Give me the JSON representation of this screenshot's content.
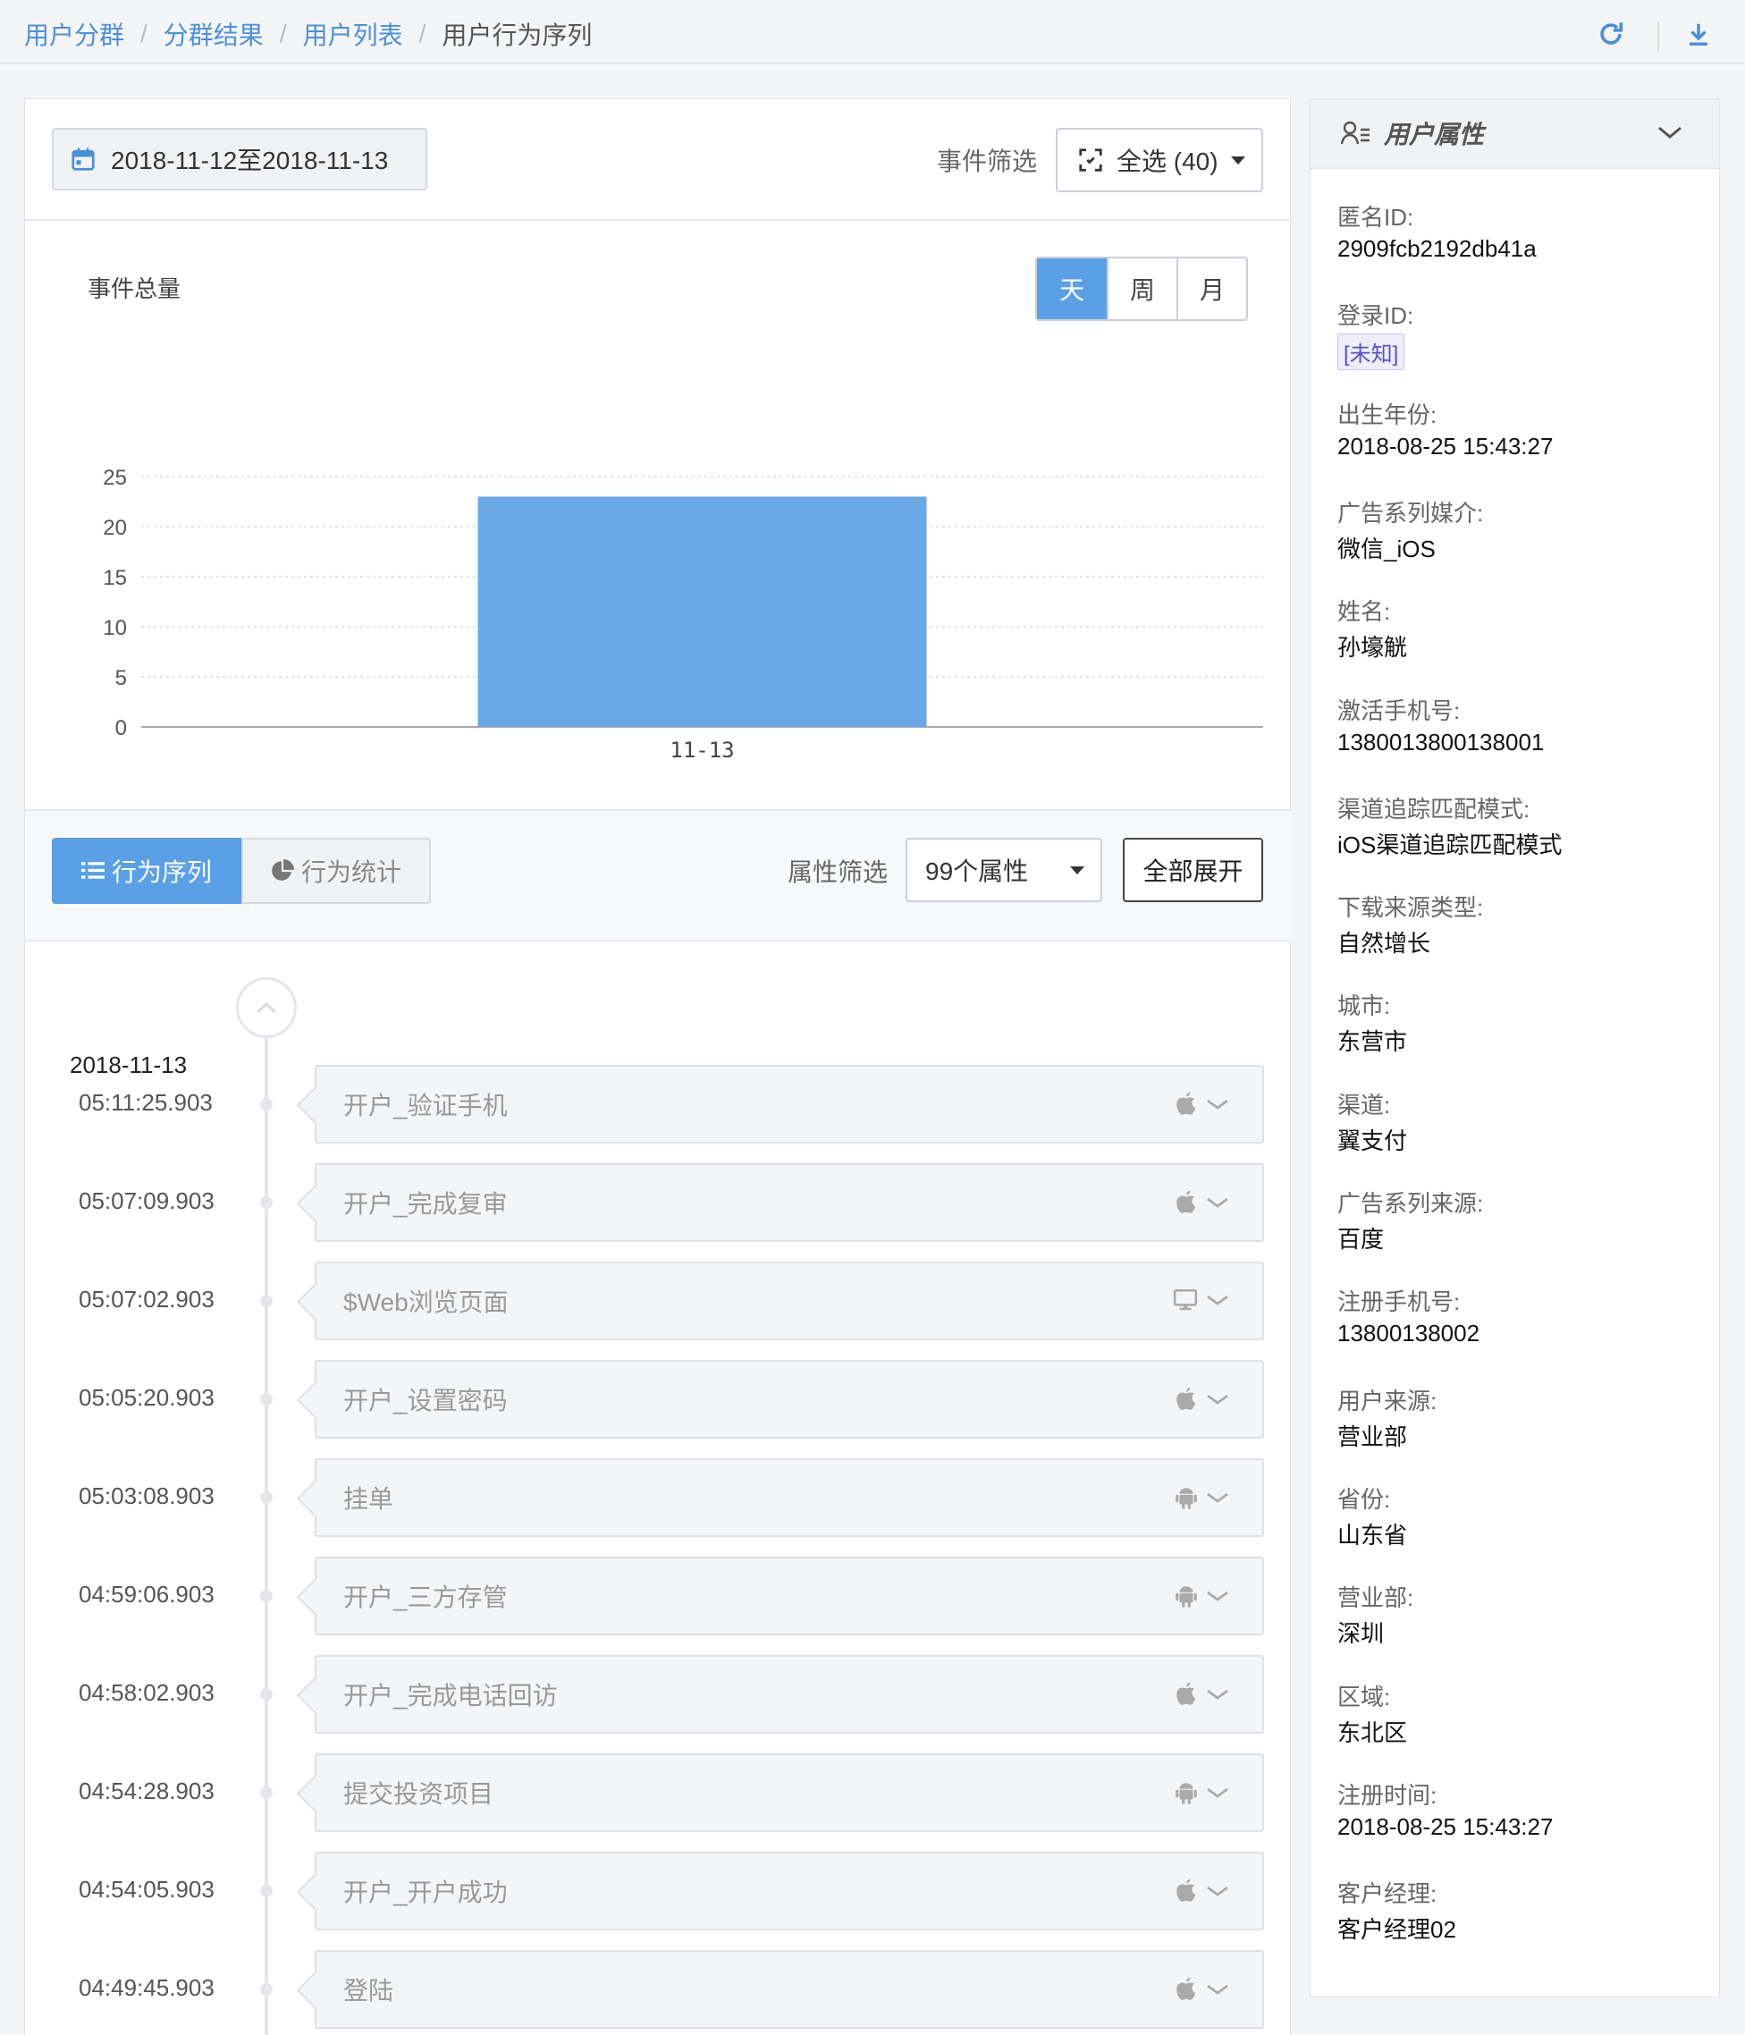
{
  "breadcrumb": [
    "用户分群",
    "分群结果",
    "用户列表",
    "用户行为序列"
  ],
  "toolbar": {
    "refresh_icon": "refresh-icon",
    "download_icon": "download-icon"
  },
  "filters": {
    "date_range": "2018-11-12至2018-11-13",
    "event_filter_label": "事件筛选",
    "event_filter_value": "全选 (40)"
  },
  "chart_data": {
    "type": "bar",
    "title": "事件总量",
    "categories": [
      "11-13"
    ],
    "values": [
      23
    ],
    "ylim": [
      0,
      25
    ],
    "yticks": [
      0,
      5,
      10,
      15,
      20,
      25
    ],
    "grid": true,
    "color": "#6aa9e6"
  },
  "granularity": {
    "options": [
      "天",
      "周",
      "月"
    ],
    "selected": "天"
  },
  "tabs": {
    "sequence": "行为序列",
    "stats": "行为统计"
  },
  "attr_filter": {
    "label": "属性筛选",
    "value": "99个属性",
    "expand_all": "全部展开"
  },
  "timeline": {
    "date": "2018-11-13",
    "events": [
      {
        "time": "05:11:25.903",
        "name": "开户_验证手机",
        "platform": "apple"
      },
      {
        "time": "05:07:09.903",
        "name": "开户_完成复审",
        "platform": "apple"
      },
      {
        "time": "05:07:02.903",
        "name": "$Web浏览页面",
        "platform": "desktop"
      },
      {
        "time": "05:05:20.903",
        "name": "开户_设置密码",
        "platform": "apple"
      },
      {
        "time": "05:03:08.903",
        "name": "挂单",
        "platform": "android"
      },
      {
        "time": "04:59:06.903",
        "name": "开户_三方存管",
        "platform": "android"
      },
      {
        "time": "04:58:02.903",
        "name": "开户_完成电话回访",
        "platform": "apple"
      },
      {
        "time": "04:54:28.903",
        "name": "提交投资项目",
        "platform": "android"
      },
      {
        "time": "04:54:05.903",
        "name": "开户_开户成功",
        "platform": "apple"
      },
      {
        "time": "04:49:45.903",
        "name": "登陆",
        "platform": "apple"
      }
    ]
  },
  "user_props": {
    "title": "用户属性",
    "items": [
      {
        "key": "匿名ID:",
        "value": "2909fcb2192db41a"
      },
      {
        "key": "登录ID:",
        "value": "[未知]",
        "tag": true
      },
      {
        "key": "出生年份:",
        "value": "2018-08-25 15:43:27"
      },
      {
        "key": "广告系列媒介:",
        "value": "微信_iOS"
      },
      {
        "key": "姓名:",
        "value": "孙壕觥"
      },
      {
        "key": "激活手机号:",
        "value": "1380013800138001"
      },
      {
        "key": "渠道追踪匹配模式:",
        "value": "iOS渠道追踪匹配模式"
      },
      {
        "key": "下载来源类型:",
        "value": "自然增长"
      },
      {
        "key": "城市:",
        "value": "东营市"
      },
      {
        "key": "渠道:",
        "value": "翼支付"
      },
      {
        "key": "广告系列来源:",
        "value": "百度"
      },
      {
        "key": "注册手机号:",
        "value": "13800138002"
      },
      {
        "key": "用户来源:",
        "value": "营业部"
      },
      {
        "key": "省份:",
        "value": "山东省"
      },
      {
        "key": "营业部:",
        "value": "深圳"
      },
      {
        "key": "区域:",
        "value": "东北区"
      },
      {
        "key": "注册时间:",
        "value": "2018-08-25 15:43:27"
      },
      {
        "key": "客户经理:",
        "value": "客户经理02"
      }
    ]
  }
}
